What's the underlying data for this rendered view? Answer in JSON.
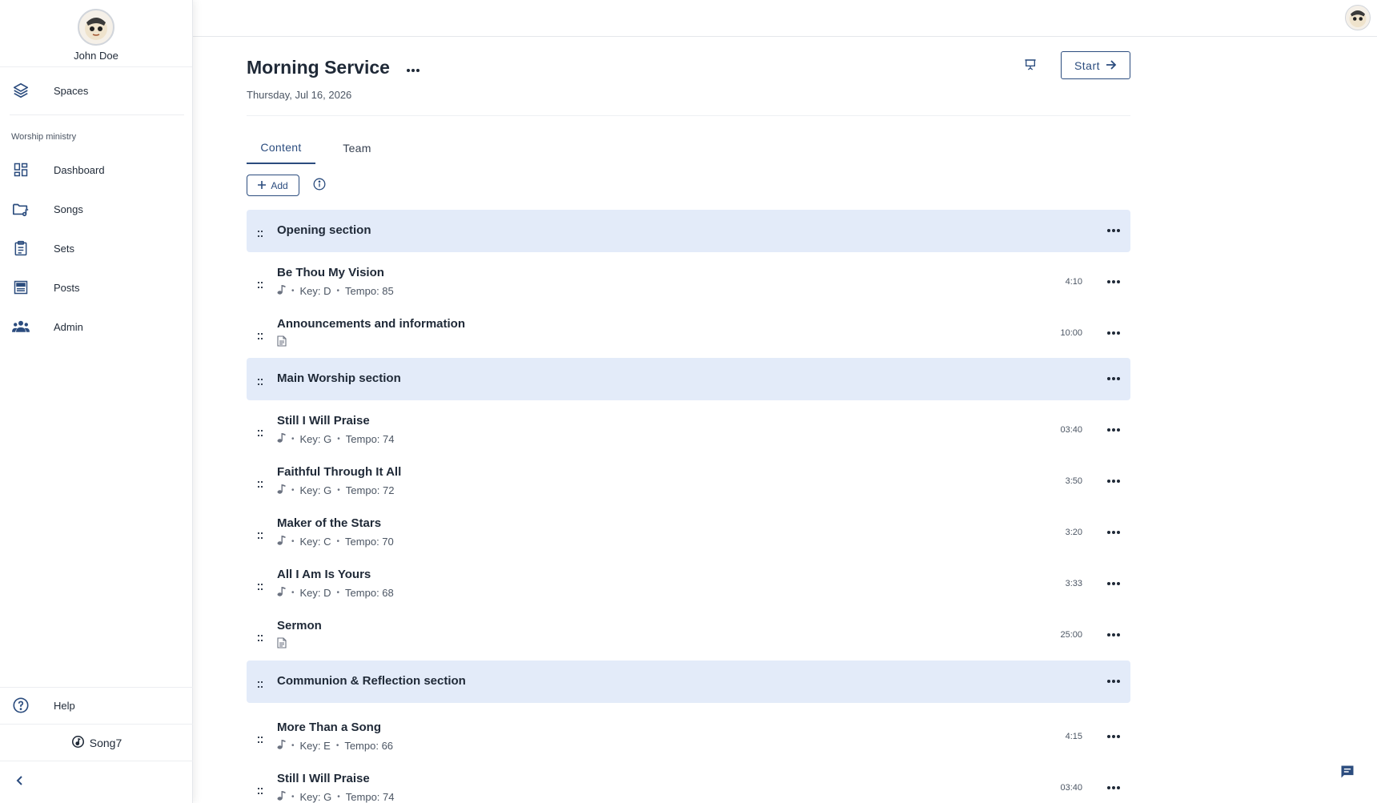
{
  "user": {
    "name": "John Doe"
  },
  "sidebar": {
    "spaces_label": "Spaces",
    "section_caption": "Worship ministry",
    "items": [
      {
        "label": "Dashboard",
        "icon": "dashboard-icon"
      },
      {
        "label": "Songs",
        "icon": "music-folder-icon"
      },
      {
        "label": "Sets",
        "icon": "clipboard-icon"
      },
      {
        "label": "Posts",
        "icon": "posts-icon"
      },
      {
        "label": "Admin",
        "icon": "people-icon"
      }
    ],
    "help_label": "Help",
    "brand": "Song7"
  },
  "page": {
    "title": "Morning Service",
    "date": "Thursday, Jul 16, 2026",
    "start_label": "Start",
    "tabs": [
      {
        "label": "Content"
      },
      {
        "label": "Team"
      }
    ],
    "add_label": "Add"
  },
  "rows": [
    {
      "type": "section",
      "title": "Opening section"
    },
    {
      "type": "song",
      "title": "Be Thou My Vision",
      "key": "Key: D",
      "tempo": "Tempo: 85",
      "duration": "4:10"
    },
    {
      "type": "doc",
      "title": "Announcements and information",
      "duration": "10:00"
    },
    {
      "type": "section",
      "title": "Main Worship section"
    },
    {
      "type": "song",
      "title": "Still I Will Praise",
      "key": "Key: G",
      "tempo": "Tempo: 74",
      "duration": "03:40"
    },
    {
      "type": "song",
      "title": "Faithful Through It All",
      "key": "Key: G",
      "tempo": "Tempo: 72",
      "duration": "3:50"
    },
    {
      "type": "song",
      "title": "Maker of the Stars",
      "key": "Key: C",
      "tempo": "Tempo: 70",
      "duration": "3:20"
    },
    {
      "type": "song",
      "title": "All I Am Is Yours",
      "key": "Key: D",
      "tempo": "Tempo: 68",
      "duration": "3:33"
    },
    {
      "type": "doc",
      "title": "Sermon",
      "duration": "25:00"
    },
    {
      "type": "section",
      "title": "Communion & Reflection section"
    },
    {
      "type": "song",
      "title": "More Than a Song",
      "key": "Key: E",
      "tempo": "Tempo: 66",
      "duration": "4:15"
    },
    {
      "type": "song",
      "title": "Still I Will Praise",
      "key": "Key: G",
      "tempo": "Tempo: 74",
      "duration": "03:40"
    }
  ],
  "colors": {
    "accent": "#2b4c7e",
    "section_bg": "#e3ebf9",
    "nav_icon": "#2b4c7e"
  }
}
